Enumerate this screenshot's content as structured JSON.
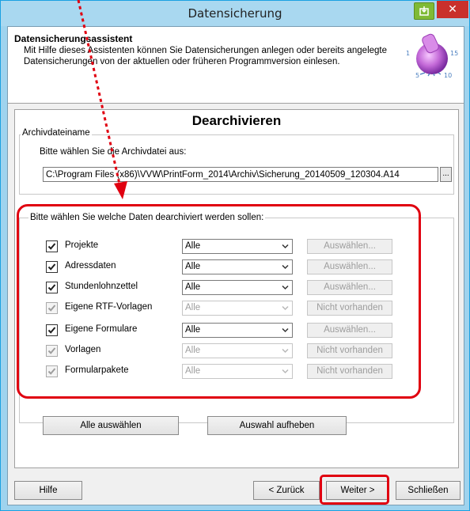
{
  "window": {
    "title": "Datensicherung",
    "close_glyph": "✕"
  },
  "header": {
    "title": "Datensicherungsassistent",
    "description": "Mit Hilfe dieses Assistenten können Sie Datensicherungen anlegen oder bereits angelegte Datensicherungen von der aktuellen oder früheren Programmversion einlesen.",
    "icon": "dial-knob-icon"
  },
  "page": {
    "title": "Dearchivieren"
  },
  "archive": {
    "group_label": "Archivdateiname",
    "prompt": "Bitte wählen Sie die Archivdatei aus:",
    "path": "C:\\Program Files (x86)\\VVW\\PrintForm_2014\\Archiv\\Sicherung_20140509_120304.A14",
    "browse_label": "..."
  },
  "selection": {
    "prompt": "Bitte wählen Sie welche Daten dearchiviert werden sollen:",
    "rows": [
      {
        "label": "Projekte",
        "checked": true,
        "enabled": true,
        "option": "Alle",
        "action": "Auswählen..."
      },
      {
        "label": "Adressdaten",
        "checked": true,
        "enabled": true,
        "option": "Alle",
        "action": "Auswählen..."
      },
      {
        "label": "Stundenlohnzettel",
        "checked": true,
        "enabled": true,
        "option": "Alle",
        "action": "Auswählen..."
      },
      {
        "label": "Eigene RTF-Vorlagen",
        "checked": true,
        "enabled": false,
        "option": "Alle",
        "action": "Nicht vorhanden"
      },
      {
        "label": "Eigene Formulare",
        "checked": true,
        "enabled": true,
        "option": "Alle",
        "action": "Auswählen..."
      },
      {
        "label": "Vorlagen",
        "checked": true,
        "enabled": false,
        "option": "Alle",
        "action": "Nicht vorhanden"
      },
      {
        "label": "Formularpakete",
        "checked": true,
        "enabled": false,
        "option": "Alle",
        "action": "Nicht vorhanden"
      }
    ]
  },
  "bulk": {
    "select_all": "Alle auswählen",
    "deselect_all": "Auswahl aufheben"
  },
  "footer": {
    "help": "Hilfe",
    "back": "< Zurück",
    "next": "Weiter >",
    "close": "Schließen"
  },
  "colors": {
    "highlight": "#e00010",
    "titlebar": "#a9d8f0",
    "close": "#c9302c"
  }
}
